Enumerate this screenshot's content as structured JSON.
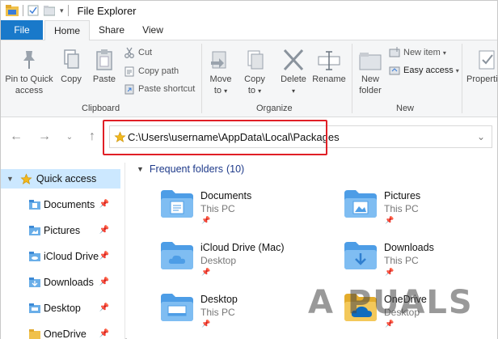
{
  "window": {
    "title": "File Explorer"
  },
  "tabs": {
    "file": "File",
    "home": "Home",
    "share": "Share",
    "view": "View"
  },
  "ribbon": {
    "clipboard": {
      "group_label": "Clipboard",
      "pin_label_1": "Pin to Quick",
      "pin_label_2": "access",
      "copy": "Copy",
      "paste": "Paste",
      "cut": "Cut",
      "copy_path": "Copy path",
      "paste_shortcut": "Paste shortcut"
    },
    "organize": {
      "group_label": "Organize",
      "move_to_1": "Move",
      "move_to_2": "to",
      "copy_to_1": "Copy",
      "copy_to_2": "to",
      "delete": "Delete",
      "rename": "Rename"
    },
    "new": {
      "group_label": "New",
      "new_folder_1": "New",
      "new_folder_2": "folder",
      "new_item": "New item",
      "easy_access": "Easy access"
    },
    "open": {
      "properties": "Properti"
    }
  },
  "address": {
    "path": "C:\\Users\\username\\AppData\\Local\\Packages"
  },
  "nav": {
    "quick_access": "Quick access",
    "items": [
      {
        "label": "Documents"
      },
      {
        "label": "Pictures"
      },
      {
        "label": "iCloud Drive"
      },
      {
        "label": "Downloads"
      },
      {
        "label": "Desktop"
      },
      {
        "label": "OneDrive"
      }
    ]
  },
  "content": {
    "section_title": "Frequent folders",
    "section_count": "(10)",
    "folders": [
      {
        "name": "Documents",
        "location": "This PC",
        "icon": "documents-folder-icon"
      },
      {
        "name": "Pictures",
        "location": "This PC",
        "icon": "pictures-folder-icon"
      },
      {
        "name": "iCloud Drive (Mac)",
        "location": "Desktop",
        "icon": "icloud-folder-icon"
      },
      {
        "name": "Downloads",
        "location": "This PC",
        "icon": "downloads-folder-icon"
      },
      {
        "name": "Desktop",
        "location": "This PC",
        "icon": "desktop-folder-icon"
      },
      {
        "name": "OneDrive",
        "location": "Desktop",
        "icon": "onedrive-folder-icon"
      }
    ]
  },
  "watermark": "A  PUALS",
  "colors": {
    "accent": "#1979ca",
    "highlight": "#cce8ff",
    "annotation": "#e01f26"
  }
}
